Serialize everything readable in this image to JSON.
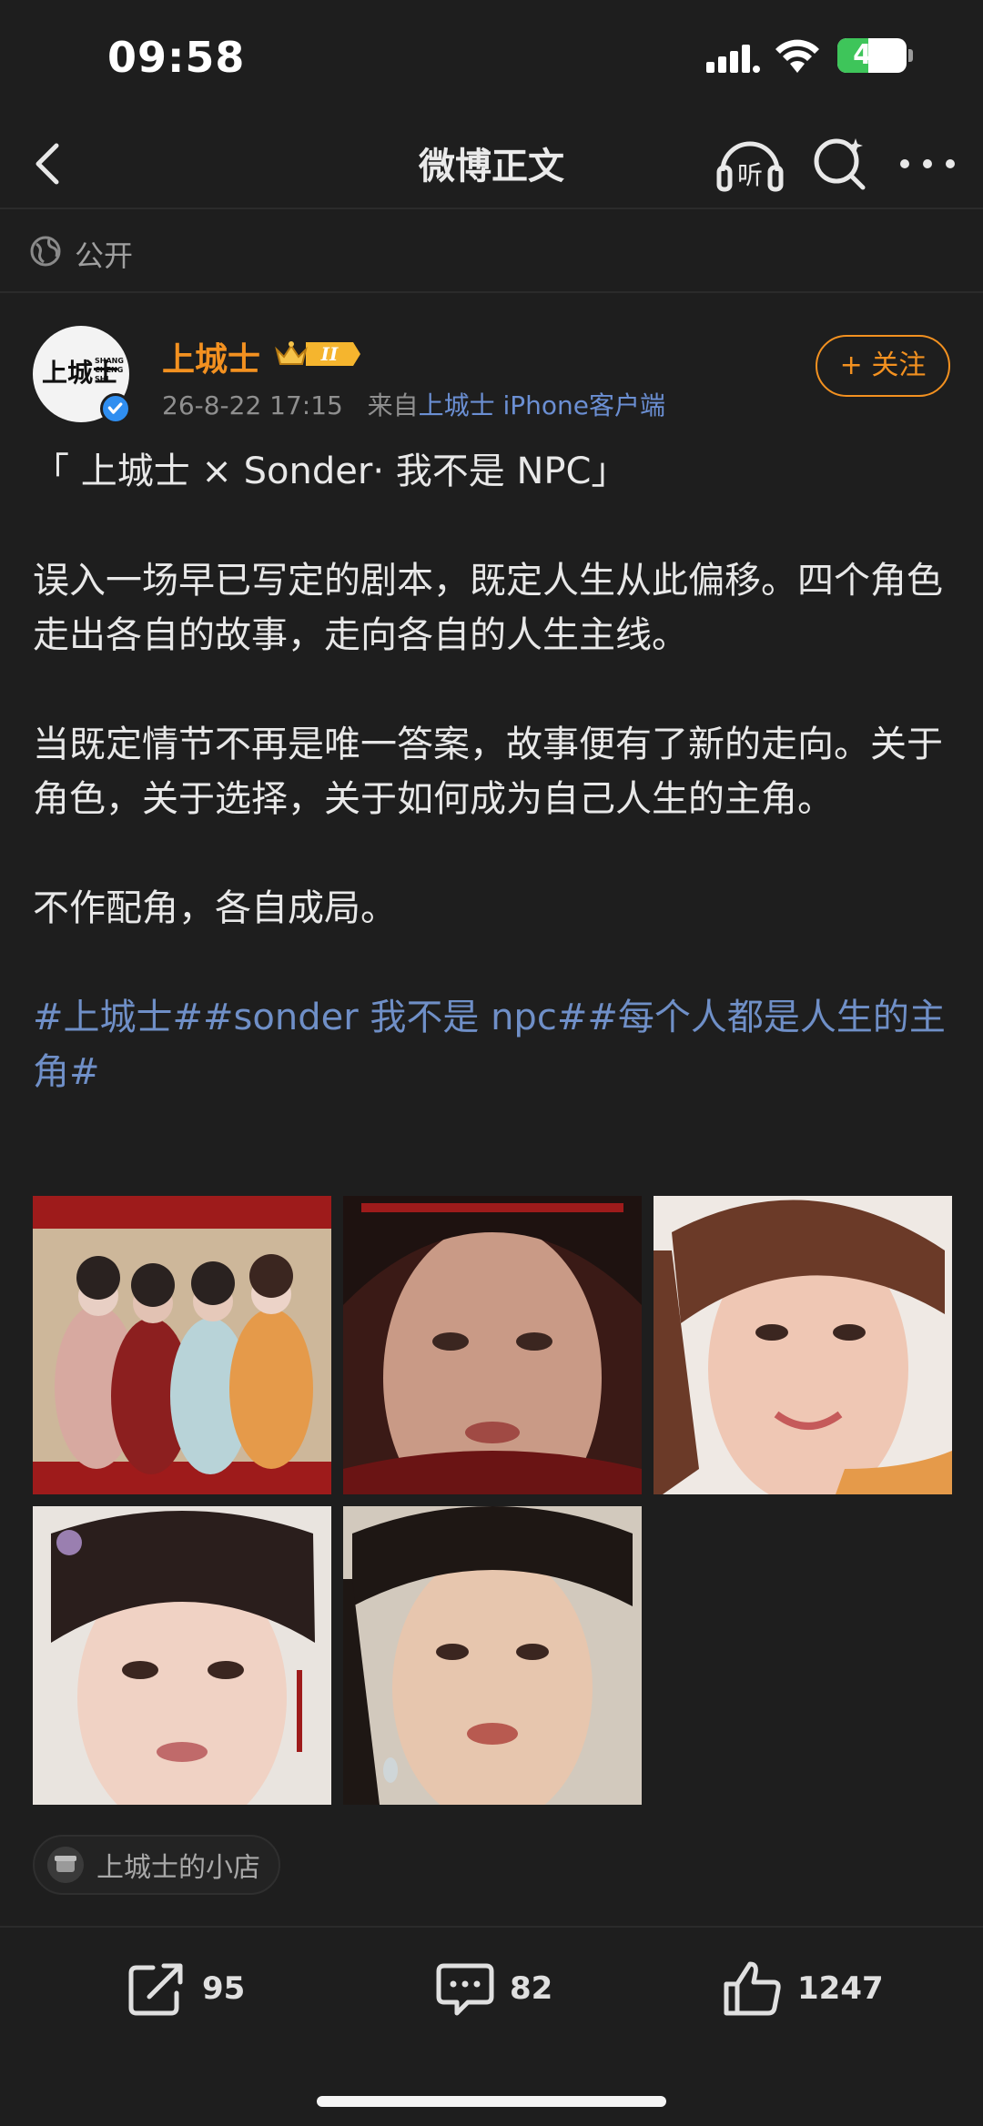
{
  "status_bar": {
    "time": "09:58",
    "battery": "45",
    "battery_level": 0.45
  },
  "nav": {
    "title": "微博正文",
    "listen_label": "听"
  },
  "visibility": {
    "label": "公开"
  },
  "author": {
    "name": "上城士",
    "avatar_text_cn": "上城士",
    "avatar_text_en_1": "SHANG",
    "avatar_text_en_2": "CHENG",
    "avatar_text_en_3": "SHI",
    "badge_level": "II",
    "time": "26-8-22 17:15",
    "source_prefix": "来自",
    "source": "上城士 iPhone客户端",
    "follow_label": "+ 关注"
  },
  "post": {
    "title_line": "「 上城士 × Sonder· 我不是 NPC」",
    "paragraph_1": "误入一场早已写定的剧本，既定人生从此偏移。四个角色走出各自的故事，走向各自的人生主线。",
    "paragraph_2": "当既定情节不再是唯一答案，故事便有了新的走向。关于角色，关于选择，关于如何成为自己人生的主角。",
    "paragraph_3": "不作配角，各自成局。",
    "tags": "#上城士##sonder 我不是 npc##每个人都是人生的主角#"
  },
  "images": [
    {
      "name": "group-photo",
      "bg": "#cdb79a"
    },
    {
      "name": "portrait-2",
      "bg": "#6b3a2e"
    },
    {
      "name": "portrait-3",
      "bg": "#efe9e4"
    },
    {
      "name": "portrait-4",
      "bg": "#e9e4df"
    },
    {
      "name": "portrait-5",
      "bg": "#d2c9bd"
    }
  ],
  "shop": {
    "label": "上城士的小店"
  },
  "actions": {
    "repost_count": "95",
    "comment_count": "82",
    "like_count": "1247"
  },
  "colors": {
    "accent_orange": "#f39120",
    "link_blue": "#6f8fc7",
    "background": "#1e1e1e"
  }
}
